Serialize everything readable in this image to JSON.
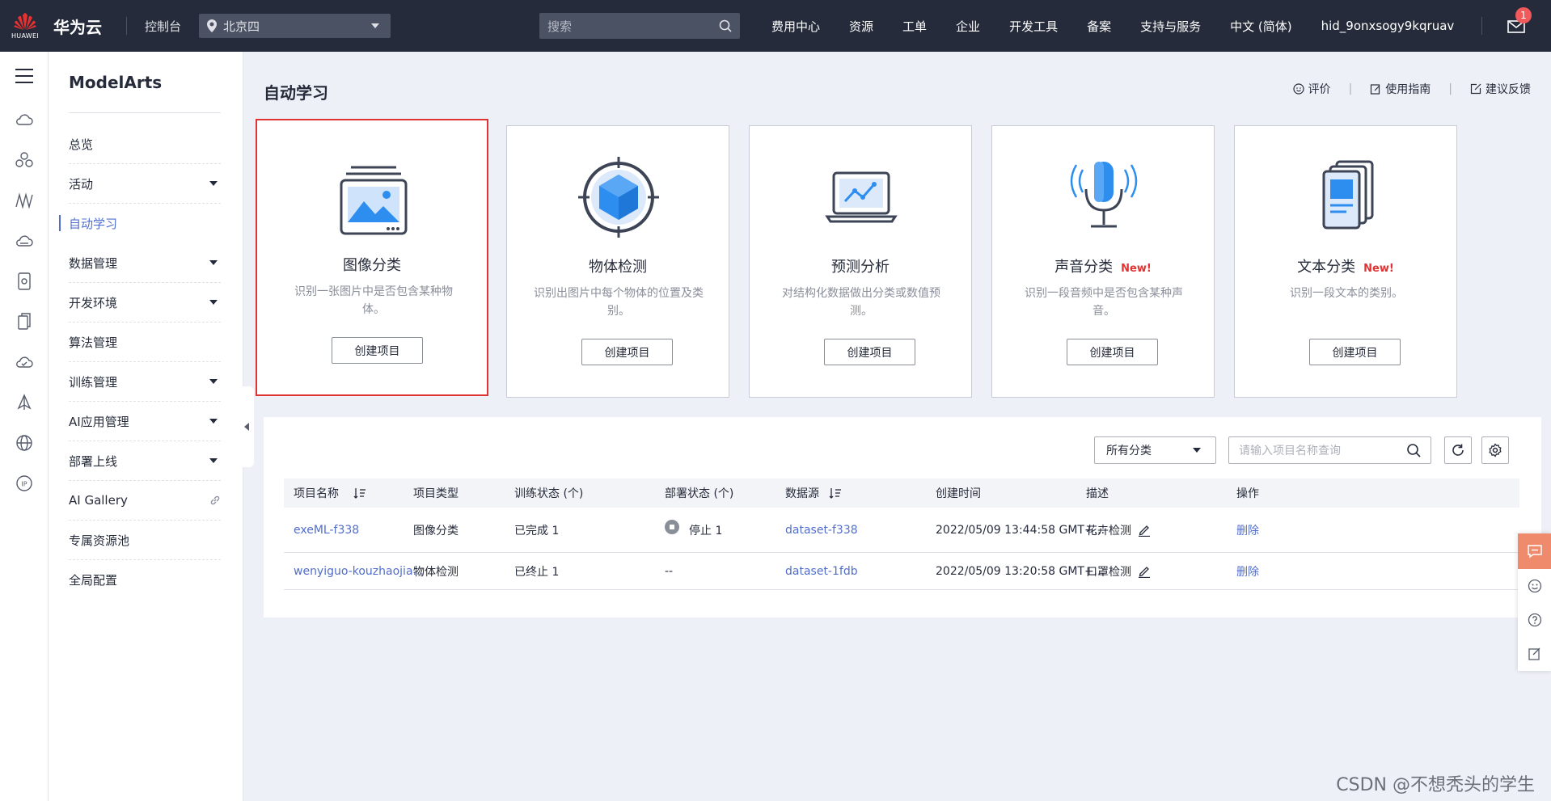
{
  "header": {
    "logo_text": "HUAWEI",
    "brand": "华为云",
    "console": "控制台",
    "region": "北京四",
    "search_placeholder": "搜索",
    "nav": [
      "费用中心",
      "资源",
      "工单",
      "企业",
      "开发工具",
      "备案",
      "支持与服务",
      "中文 (简体)",
      "hid_9onxsogy9kqruav"
    ],
    "mail_badge": "1"
  },
  "sidebar": {
    "title": "ModelArts",
    "items": [
      {
        "label": "总览",
        "has_caret": false
      },
      {
        "label": "活动",
        "has_caret": true
      },
      {
        "label": "自动学习",
        "has_caret": false,
        "active": true
      },
      {
        "label": "数据管理",
        "has_caret": true
      },
      {
        "label": "开发环境",
        "has_caret": true
      },
      {
        "label": "算法管理",
        "has_caret": false
      },
      {
        "label": "训练管理",
        "has_caret": true
      },
      {
        "label": "AI应用管理",
        "has_caret": true
      },
      {
        "label": "部署上线",
        "has_caret": true
      },
      {
        "label": "AI Gallery",
        "has_link": true
      },
      {
        "label": "专属资源池",
        "has_caret": false
      },
      {
        "label": "全局配置",
        "has_caret": false
      }
    ]
  },
  "main": {
    "title": "自动学习",
    "links": [
      "评价",
      "使用指南",
      "建议反馈"
    ],
    "cards": [
      {
        "name": "图像分类",
        "desc": "识别一张图片中是否包含某种物体。",
        "button": "创建项目",
        "new": "",
        "icon": "image-classification-icon"
      },
      {
        "name": "物体检测",
        "desc": "识别出图片中每个物体的位置及类别。",
        "button": "创建项目",
        "new": "",
        "icon": "object-detection-icon"
      },
      {
        "name": "预测分析",
        "desc": "对结构化数据做出分类或数值预测。",
        "button": "创建项目",
        "new": "",
        "icon": "predictive-analysis-icon"
      },
      {
        "name": "声音分类",
        "desc": "识别一段音频中是否包含某种声音。",
        "button": "创建项目",
        "new": "New!",
        "icon": "sound-classification-icon"
      },
      {
        "name": "文本分类",
        "desc": "识别一段文本的类别。",
        "button": "创建项目",
        "new": "New!",
        "icon": "text-classification-icon"
      }
    ],
    "filter": "所有分类",
    "query_placeholder": "请输入项目名称查询",
    "table": {
      "headers": [
        "项目名称",
        "项目类型",
        "训练状态 (个)",
        "部署状态 (个)",
        "数据源",
        "创建时间",
        "描述",
        "操作"
      ],
      "rows": [
        {
          "name": "exeML-f338",
          "type": "图像分类",
          "train": "已完成 1",
          "deploy": "停止 1",
          "deploy_icon": true,
          "source": "dataset-f338",
          "time": "2022/05/09 13:44:58 GMT+...",
          "desc": "花卉检测",
          "op": "删除"
        },
        {
          "name": "wenyiguo-kouzhaojia...",
          "type": "物体检测",
          "train": "已终止 1",
          "deploy": "--",
          "deploy_icon": false,
          "source": "dataset-1fdb",
          "time": "2022/05/09 13:20:58 GMT+...",
          "desc": "口罩检测",
          "op": "删除"
        }
      ]
    }
  },
  "watermark": "CSDN @不想秃头的学生"
}
